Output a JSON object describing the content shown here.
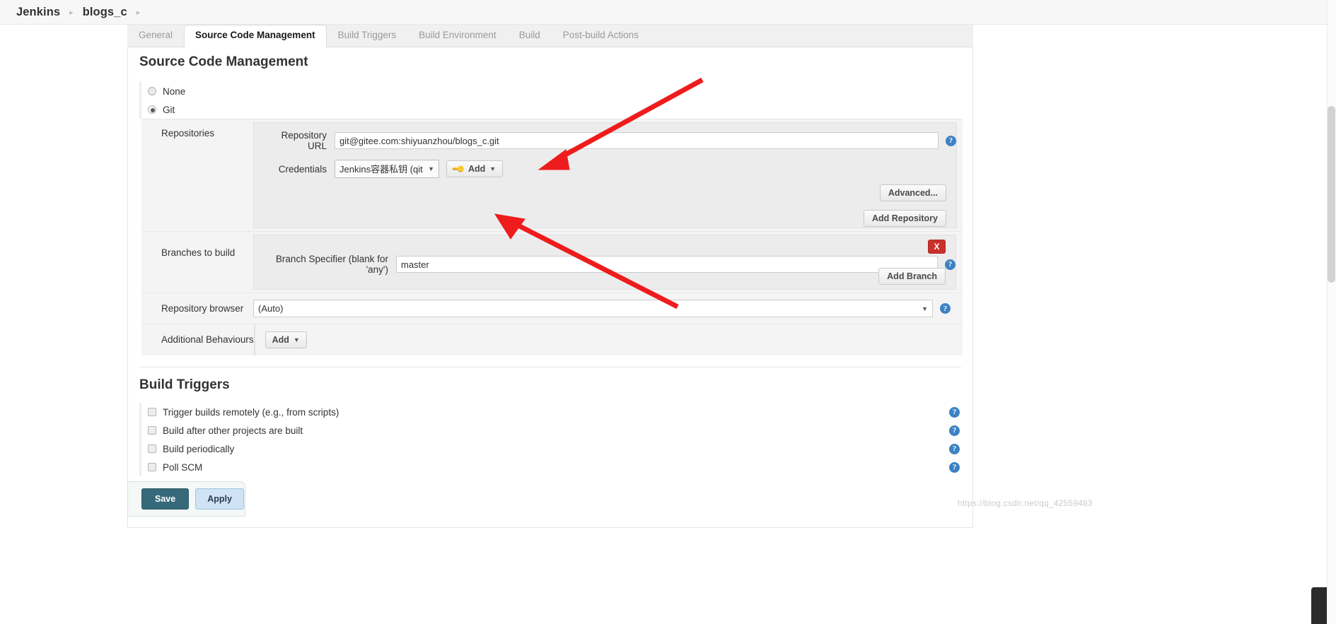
{
  "breadcrumb": {
    "items": [
      "Jenkins",
      "blogs_c"
    ],
    "separator": "▸"
  },
  "tabs": [
    {
      "label": "General",
      "active": false
    },
    {
      "label": "Source Code Management",
      "active": true
    },
    {
      "label": "Build Triggers",
      "active": false
    },
    {
      "label": "Build Environment",
      "active": false
    },
    {
      "label": "Build",
      "active": false
    },
    {
      "label": "Post-build Actions",
      "active": false
    }
  ],
  "scm": {
    "heading": "Source Code Management",
    "options": [
      {
        "label": "None",
        "selected": false
      },
      {
        "label": "Git",
        "selected": true
      }
    ],
    "repositories": {
      "label": "Repositories",
      "repository_url": {
        "label": "Repository URL",
        "value": "git@gitee.com:shiyuanzhou/blogs_c.git"
      },
      "credentials": {
        "label": "Credentials",
        "value": "Jenkins容器私钥 (qitee)",
        "add_button": "Add"
      },
      "advanced_button": "Advanced...",
      "add_repository_button": "Add Repository"
    },
    "branches": {
      "label": "Branches to build",
      "branch_specifier": {
        "label": "Branch Specifier (blank for 'any')",
        "value": "master"
      },
      "delete_button": "X",
      "add_branch_button": "Add Branch"
    },
    "repository_browser": {
      "label": "Repository browser",
      "value": "(Auto)"
    },
    "additional_behaviours": {
      "label": "Additional Behaviours",
      "add_button": "Add"
    }
  },
  "build_triggers": {
    "heading": "Build Triggers",
    "items": [
      {
        "label": "Trigger builds remotely (e.g., from scripts)",
        "checked": false
      },
      {
        "label": "Build after other projects are built",
        "checked": false
      },
      {
        "label": "Build periodically",
        "checked": false
      },
      {
        "label": "Poll SCM",
        "checked": false
      }
    ]
  },
  "footer": {
    "save_label": "Save",
    "apply_label": "Apply"
  },
  "help_icon_label": "?",
  "watermark": "https://blog.csdn.net/qq_42559483",
  "colors": {
    "accent_blue": "#3c82c4",
    "save_teal": "#36697a",
    "apply_blue": "#cfe3f5",
    "delete_red": "#c9302c",
    "annotation_red": "#ee1c1c"
  }
}
